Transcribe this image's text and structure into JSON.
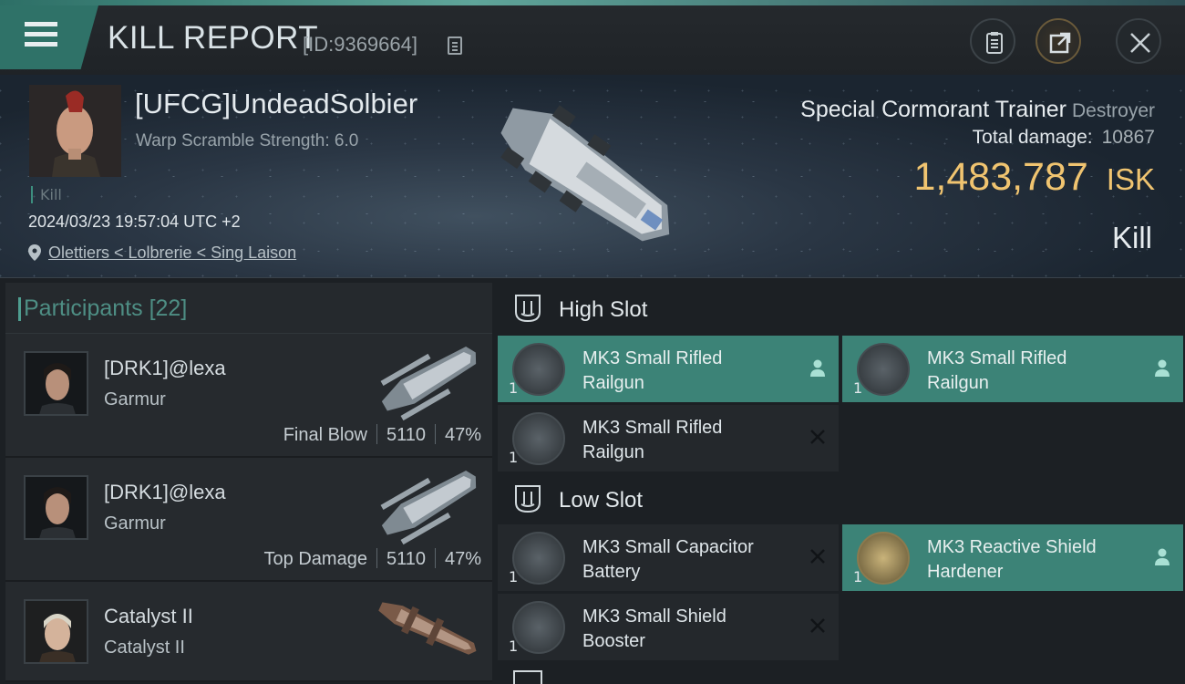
{
  "header": {
    "title": "KILL REPORT",
    "id_label": "[ID:9369664]"
  },
  "victim": {
    "pilot": "[UFCG]UndeadSolbier",
    "warp_scramble": "Warp Scramble Strength: 6.0",
    "kill_tag": "Kill",
    "datetime": "2024/03/23 19:57:04 UTC +2",
    "location": "Olettiers < Lolbrerie < Sing Laison",
    "ship_name": "Special Cormorant Trainer",
    "ship_class": "Destroyer",
    "total_damage_label": "Total damage:",
    "total_damage": "10867",
    "isk_value": "1,483,787",
    "isk_unit": "ISK",
    "result": "Kill"
  },
  "participants": {
    "label": "Participants",
    "count": "[22]",
    "list": [
      {
        "name": "[DRK1]@lexa",
        "ship": "Garmur",
        "role": "Final Blow",
        "damage": "5110",
        "percent": "47%"
      },
      {
        "name": "[DRK1]@lexa",
        "ship": "Garmur",
        "role": "Top Damage",
        "damage": "5110",
        "percent": "47%"
      },
      {
        "name": "Catalyst II",
        "ship": "Catalyst II"
      }
    ]
  },
  "fitting": {
    "high_slot": {
      "label": "High Slot",
      "modules": [
        {
          "line1": "MK3 Small Rifled",
          "line2": "Railgun",
          "qty": "1",
          "state": "pilot-icon"
        },
        {
          "line1": "MK3 Small Rifled",
          "line2": "Railgun",
          "qty": "1",
          "state": "pilot-icon"
        },
        {
          "line1": "MK3 Small Rifled",
          "line2": "Railgun",
          "qty": "1",
          "state": "destroyed-x-icon"
        }
      ]
    },
    "low_slot": {
      "label": "Low Slot",
      "modules": [
        {
          "line1": "MK3 Small Capacitor",
          "line2": "Battery",
          "qty": "1",
          "state": "destroyed-x-icon"
        },
        {
          "line1": "MK3 Reactive Shield",
          "line2": "Hardener",
          "qty": "1",
          "state": "pilot-icon"
        },
        {
          "line1": "MK3 Small Shield",
          "line2": "Booster",
          "qty": "1",
          "state": "destroyed-x-icon"
        }
      ]
    }
  },
  "colors": {
    "accent": "#3c8377",
    "isk": "#f0c470"
  }
}
